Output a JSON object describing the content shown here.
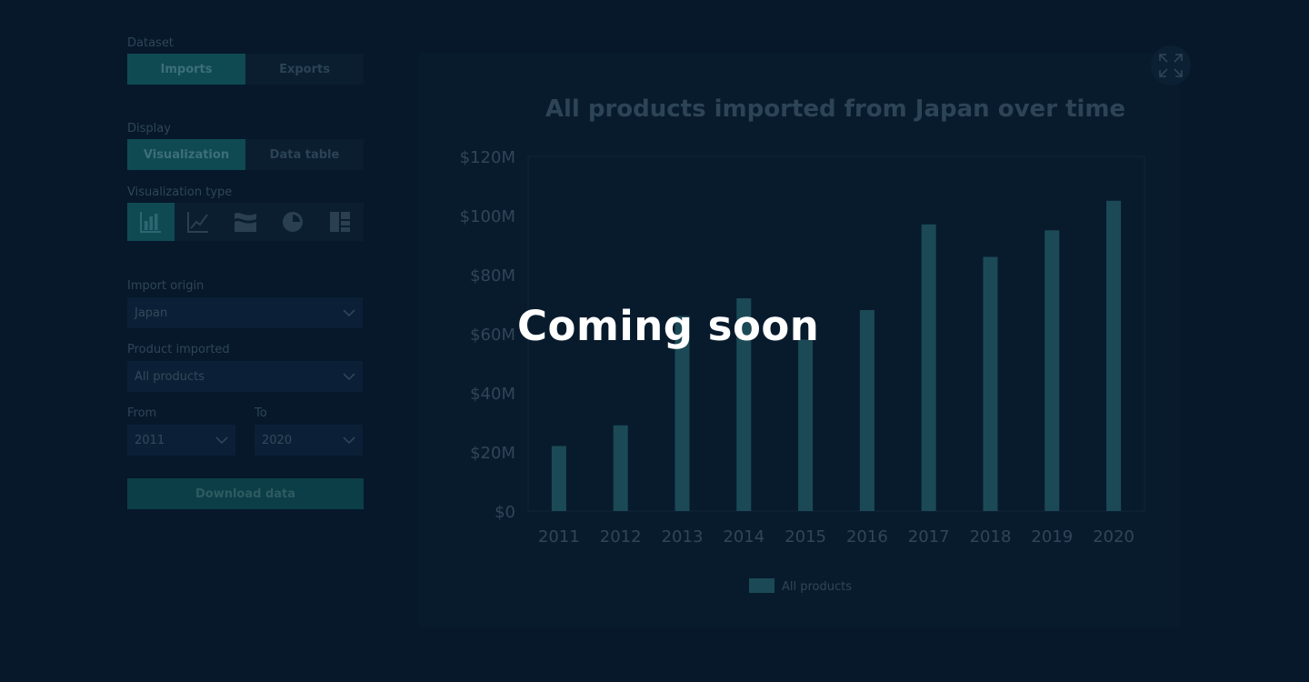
{
  "sidebar": {
    "dataset_label": "Dataset",
    "dataset_options": [
      "Imports",
      "Exports"
    ],
    "display_label": "Display",
    "display_options": [
      "Visualization",
      "Data table"
    ],
    "viz_type_label": "Visualization type",
    "viz_types": [
      "bar-chart-icon",
      "line-chart-icon",
      "stream-graph-icon",
      "pie-chart-icon",
      "treemap-icon"
    ],
    "import_origin_label": "Import origin",
    "import_origin_value": "Japan",
    "product_label": "Product imported",
    "product_value": "All products",
    "from_label": "From",
    "from_value": "2011",
    "to_label": "To",
    "to_value": "2020",
    "download_label": "Download data"
  },
  "overlay": {
    "text": "Coming soon"
  },
  "colors": {
    "accent": "#0f4a53",
    "bar": "#1b4a56",
    "background": "#06182a"
  },
  "chart_data": {
    "type": "bar",
    "title": "All products imported from Japan over time",
    "xlabel": "",
    "ylabel": "",
    "categories": [
      "2011",
      "2012",
      "2013",
      "2014",
      "2015",
      "2016",
      "2017",
      "2018",
      "2019",
      "2020"
    ],
    "series": [
      {
        "name": "All products",
        "values": [
          22,
          29,
          66,
          72,
          58,
          68,
          97,
          86,
          95,
          105
        ]
      }
    ],
    "y_ticks": [
      "$0",
      "$20M",
      "$40M",
      "$60M",
      "$80M",
      "$100M",
      "$120M"
    ],
    "ylim": [
      0,
      120
    ],
    "legend_position": "bottom",
    "grid": false
  }
}
